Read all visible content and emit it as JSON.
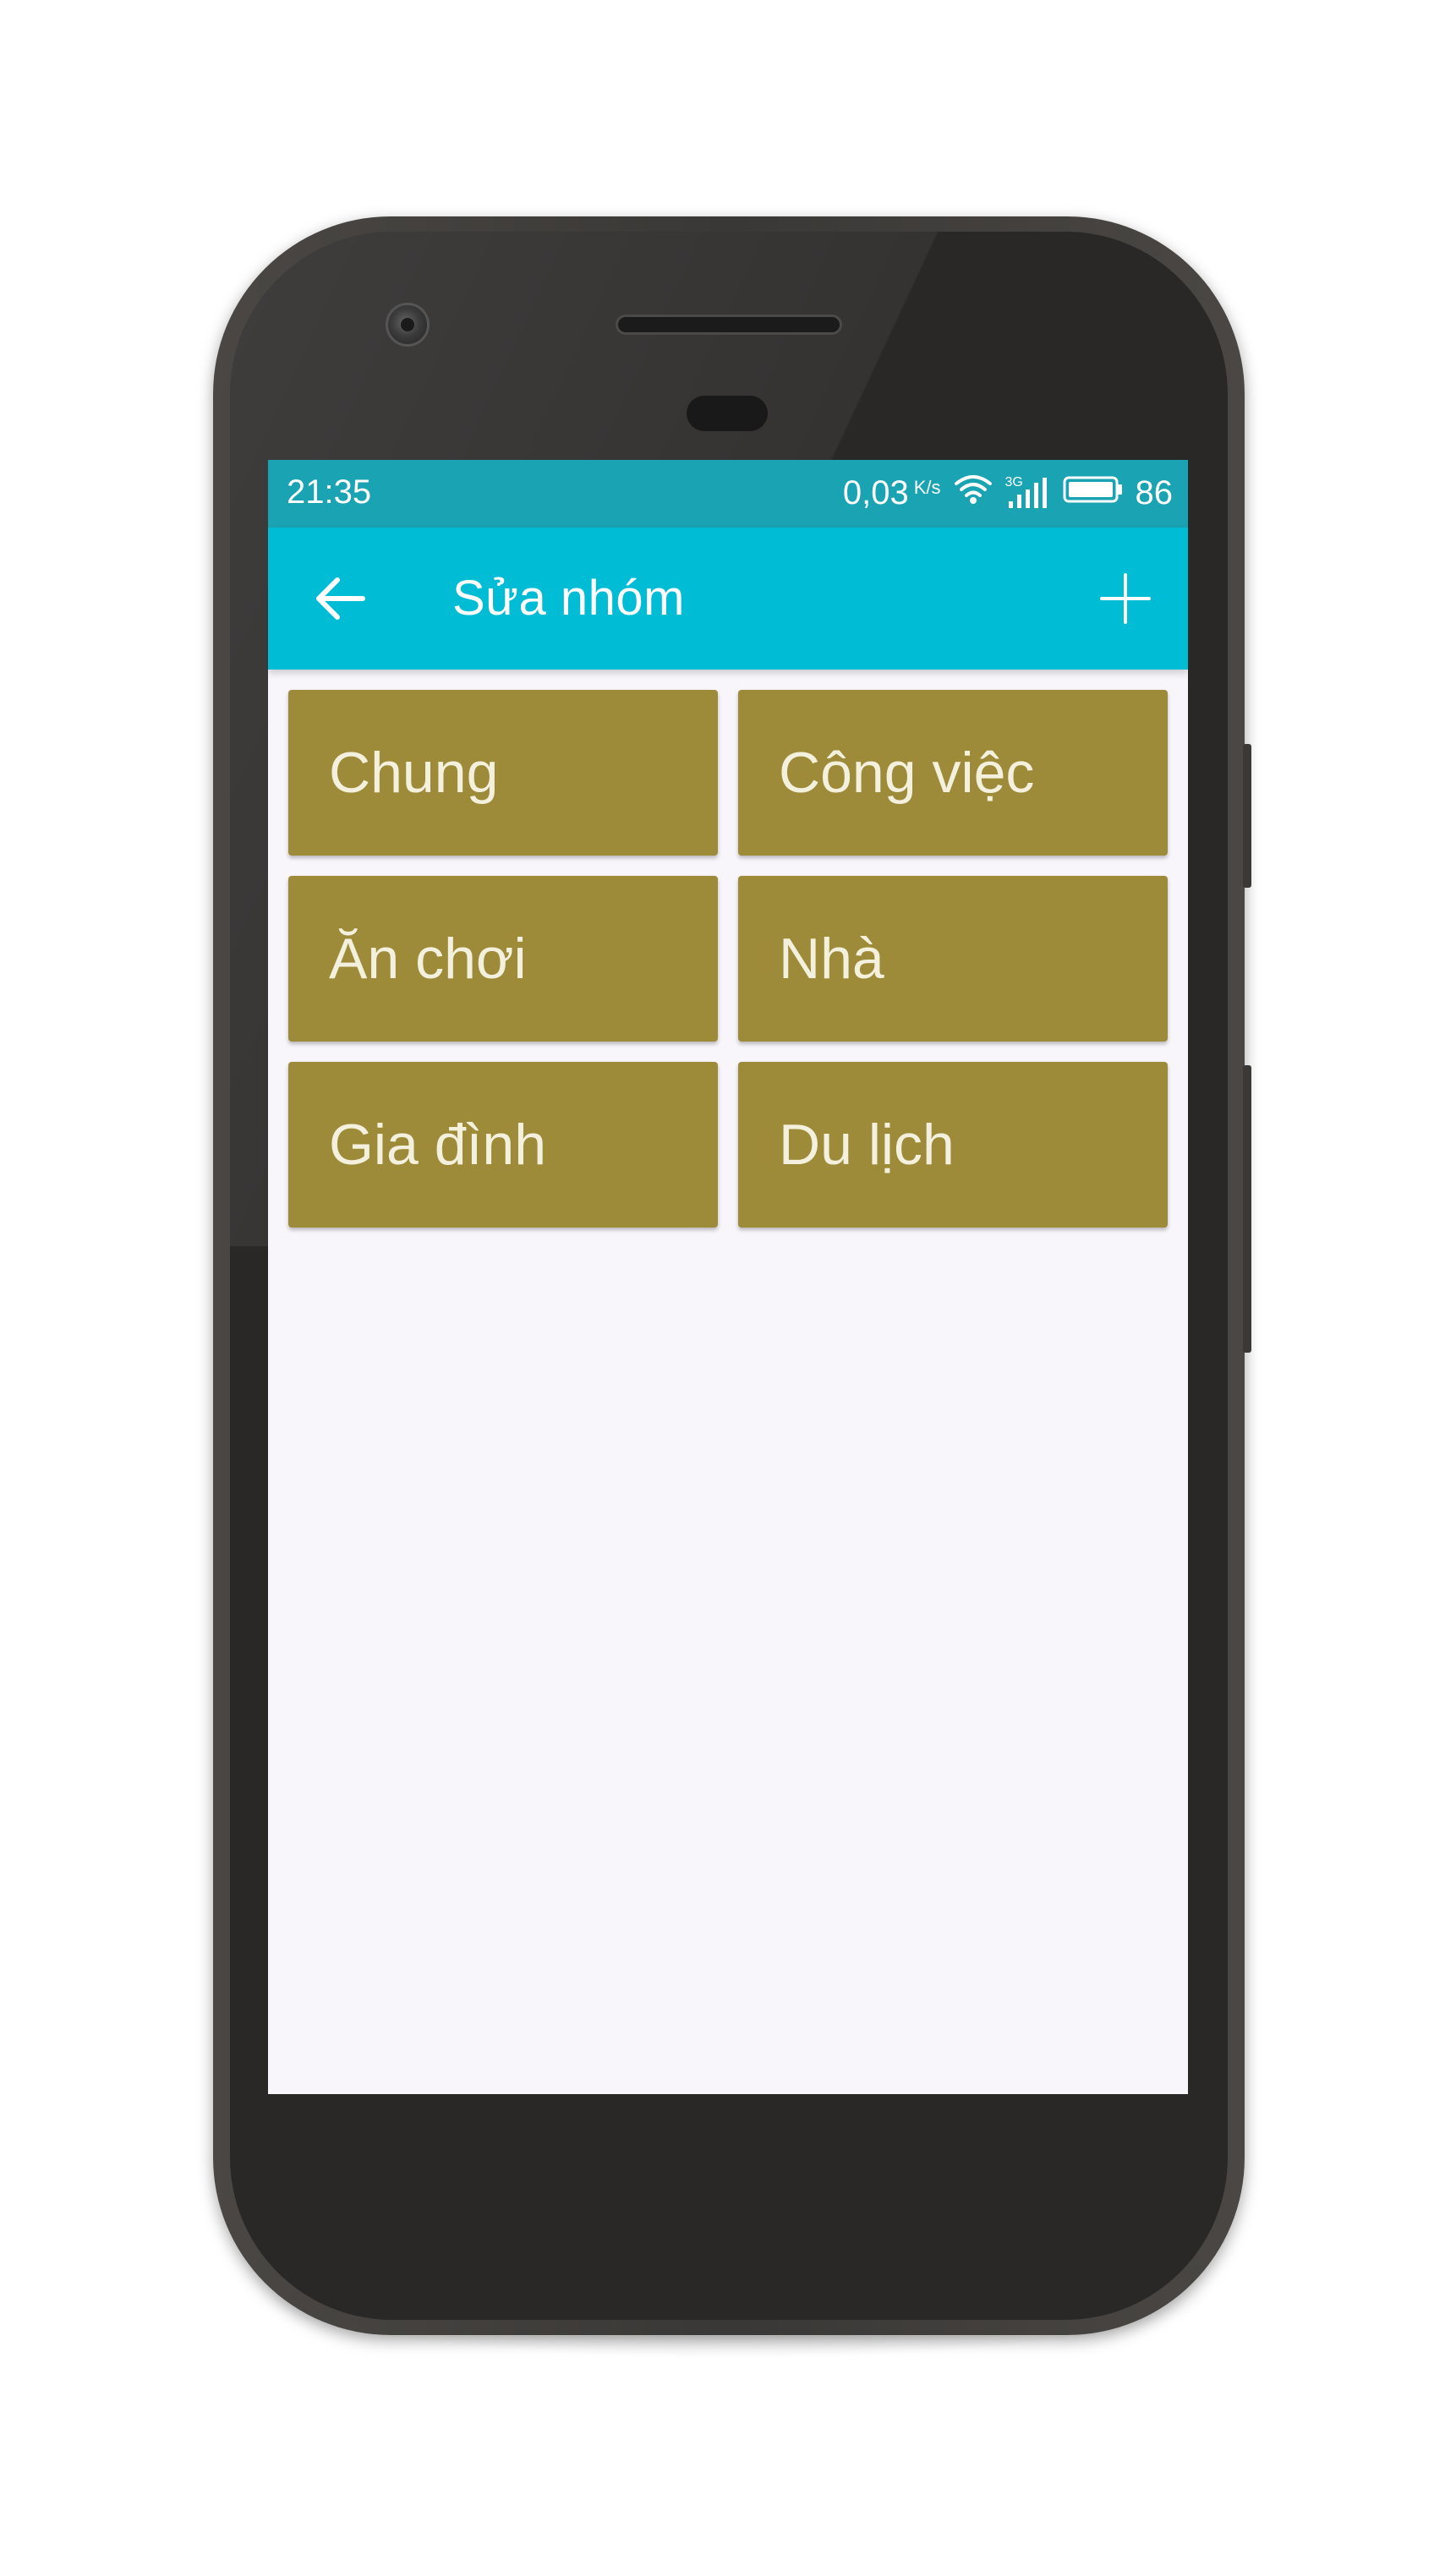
{
  "status_bar": {
    "time": "21:35",
    "net_speed": "0,03",
    "net_speed_unit": "K/s",
    "network_type": "3G",
    "battery_level": "86",
    "icons": [
      "wifi-icon",
      "signal-icon",
      "battery-icon"
    ]
  },
  "app_bar": {
    "title": "Sửa nhóm",
    "back_icon": "arrow-left-icon",
    "add_icon": "plus-icon"
  },
  "groups": [
    {
      "label": "Chung"
    },
    {
      "label": "Công việc"
    },
    {
      "label": "Ăn chơi"
    },
    {
      "label": "Nhà"
    },
    {
      "label": "Gia đình"
    },
    {
      "label": "Du lịch"
    }
  ],
  "colors": {
    "status_bar": "#1aa3b3",
    "app_bar": "#00bcd4",
    "group_card": "#9e8b39",
    "screen_background": "#f8f6fa"
  }
}
